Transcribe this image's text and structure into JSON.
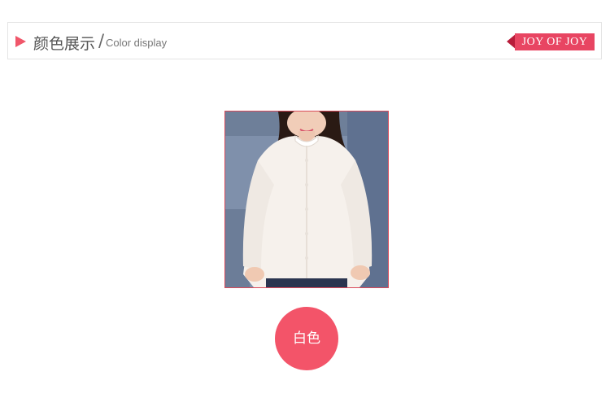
{
  "header": {
    "title_cn": "颜色展示",
    "separator": "/",
    "title_en": "Color display",
    "brand": "JOY OF JOY",
    "icon": "play-triangle-icon"
  },
  "product": {
    "image_alt": "white stand-collar long-sleeve shirt on model"
  },
  "colors": [
    {
      "label": "白色"
    }
  ],
  "theme": {
    "accent": "#f35469",
    "brand_flag": "#e84562",
    "border": "#e4e4e4"
  }
}
